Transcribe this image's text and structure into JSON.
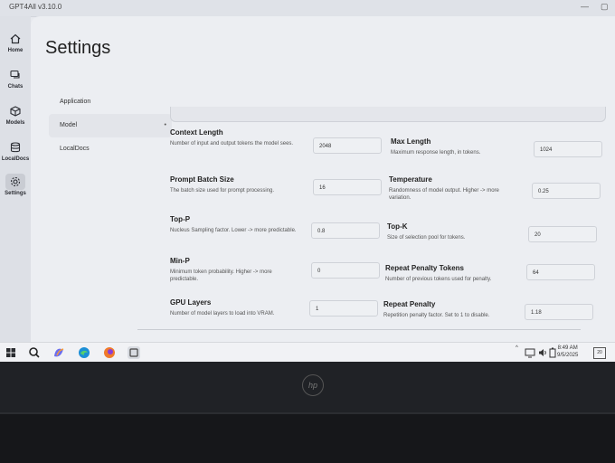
{
  "app": {
    "title": "GPT4All v3.10.0"
  },
  "sidebar": {
    "items": [
      {
        "label": "Home",
        "icon": "home-icon"
      },
      {
        "label": "Chats",
        "icon": "chat-icon"
      },
      {
        "label": "Models",
        "icon": "cube-icon"
      },
      {
        "label": "LocalDocs",
        "icon": "database-icon"
      },
      {
        "label": "Settings",
        "icon": "gear-icon",
        "active": true
      }
    ]
  },
  "page": {
    "title": "Settings"
  },
  "subnav": {
    "items": [
      {
        "label": "Application"
      },
      {
        "label": "Model",
        "active": true
      },
      {
        "label": "LocalDocs"
      }
    ]
  },
  "settings": {
    "context_length": {
      "title": "Context Length",
      "desc": "Number of input and output tokens the model sees.",
      "value": "2048"
    },
    "max_length": {
      "title": "Max Length",
      "desc": "Maximum response length, in tokens.",
      "value": "1024"
    },
    "prompt_batch": {
      "title": "Prompt Batch Size",
      "desc": "The batch size used for prompt processing.",
      "value": "16"
    },
    "temperature": {
      "title": "Temperature",
      "desc": "Randomness of model output. Higher -> more variation.",
      "value": "0.25"
    },
    "top_p": {
      "title": "Top-P",
      "desc": "Nucleus Sampling factor. Lower -> more predictable.",
      "value": "0.8"
    },
    "top_k": {
      "title": "Top-K",
      "desc": "Size of selection pool for tokens.",
      "value": "20"
    },
    "min_p": {
      "title": "Min-P",
      "desc": "Minimum token probability. Higher -> more predictable.",
      "value": "0"
    },
    "repeat_penalty_tokens": {
      "title": "Repeat Penalty Tokens",
      "desc": "Number of previous tokens used for penalty.",
      "value": "64"
    },
    "gpu_layers": {
      "title": "GPU Layers",
      "desc": "Number of model layers to load into VRAM.",
      "value": "1"
    },
    "repeat_penalty": {
      "title": "Repeat Penalty",
      "desc": "Repetition penalty factor. Set to 1 to disable.",
      "value": "1.18"
    }
  },
  "taskbar": {
    "time": "8:49 AM",
    "date": "9/5/2025",
    "notification_count": "20",
    "tray_caret": "^"
  },
  "colors": {
    "accent": "#2b2d33",
    "background": "#eceef2"
  }
}
